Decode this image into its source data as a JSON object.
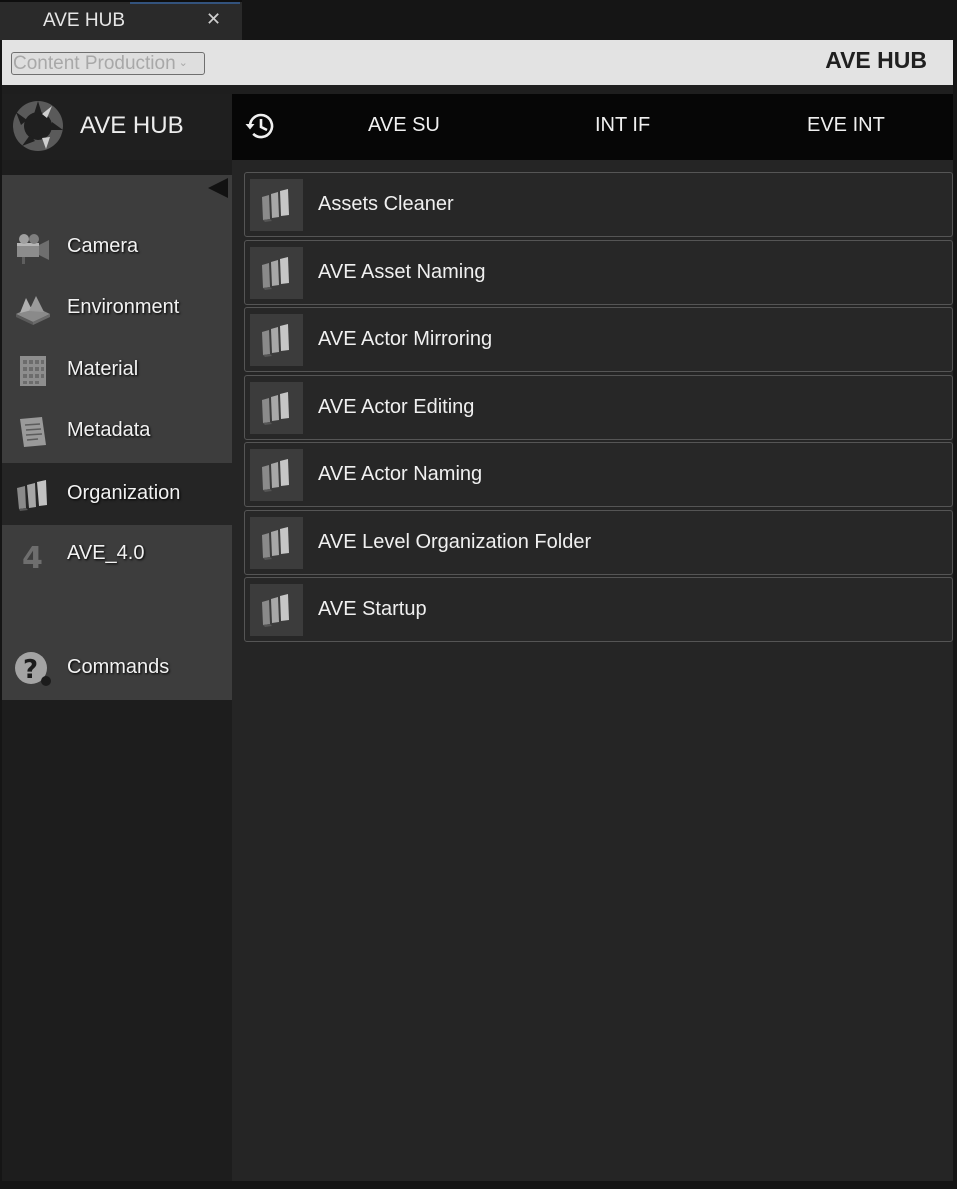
{
  "tab": {
    "title": "AVE HUB",
    "close_glyph": "✕"
  },
  "header": {
    "project_dropdown": "Content Production",
    "dropdown_chevron": "⌄",
    "app_title": "AVE HUB"
  },
  "logo": {
    "text": "AVE HUB",
    "icon": "ave-hub-logo-icon"
  },
  "nav": {
    "history_icon": "history-icon",
    "links": [
      "AVE SU",
      "INT IF",
      "EVE INT"
    ]
  },
  "sidebar": {
    "items": [
      {
        "label": "Camera",
        "icon": "camera-icon"
      },
      {
        "label": "Environment",
        "icon": "environment-icon"
      },
      {
        "label": "Material",
        "icon": "material-icon"
      },
      {
        "label": "Metadata",
        "icon": "metadata-icon"
      },
      {
        "label": "Organization",
        "icon": "organization-icon",
        "active": true
      },
      {
        "label": "AVE_4.0",
        "icon": "version-four-icon"
      },
      {
        "label": "Commands",
        "icon": "help-icon"
      }
    ]
  },
  "tools": [
    {
      "label": "Assets Cleaner"
    },
    {
      "label": "AVE Asset Naming"
    },
    {
      "label": "AVE Actor Mirroring"
    },
    {
      "label": "AVE Actor Editing"
    },
    {
      "label": "AVE Actor Naming"
    },
    {
      "label": "AVE Level Organization Folder"
    },
    {
      "label": "AVE Startup"
    }
  ],
  "colors": {
    "background": "#252525",
    "sidebar": "#3d3d3d",
    "navbar": "#060606",
    "header": "#e3e3e3",
    "tab_accent": "#3b6fb6"
  }
}
